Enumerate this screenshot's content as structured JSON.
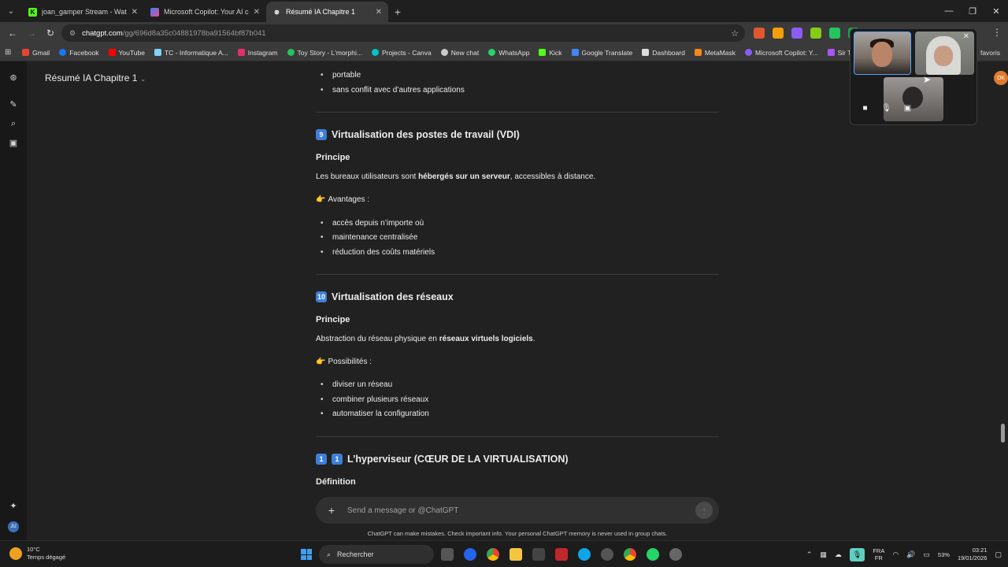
{
  "browser": {
    "tabs": [
      {
        "label": "joan_gamper Stream - Watch Li",
        "color": "#53fc18",
        "glyph": "K"
      },
      {
        "label": "Microsoft Copilot: Your AI com",
        "color": "#8a5cf6",
        "glyph": "◉"
      },
      {
        "label": "Résumé IA Chapitre 1",
        "color": "#ffffff",
        "glyph": "⊛"
      }
    ],
    "url_domain": "chatgpt.com",
    "url_path": "/gg/696d8a35c04881978ba91564bf87b041",
    "bookmarks": [
      {
        "label": "Gmail",
        "color": "#ea4335"
      },
      {
        "label": "Facebook",
        "color": "#1877f2"
      },
      {
        "label": "YouTube",
        "color": "#ff0000"
      },
      {
        "label": "TC - Informatique A...",
        "color": "#7dd3fc"
      },
      {
        "label": "Instagram",
        "color": "#e1306c"
      },
      {
        "label": "Toy Story - L'morphi...",
        "color": "#22c55e"
      },
      {
        "label": "Projects - Canva",
        "color": "#00c4cc"
      },
      {
        "label": "New chat",
        "color": "#cccccc"
      },
      {
        "label": "WhatsApp",
        "color": "#25d366"
      },
      {
        "label": "Kick",
        "color": "#53fc18"
      },
      {
        "label": "Google Translate",
        "color": "#4285f4"
      },
      {
        "label": "Dashboard",
        "color": "#dddddd"
      },
      {
        "label": "MetaMask",
        "color": "#f6851b"
      },
      {
        "label": "Microsoft Copilot: Y...",
        "color": "#8a5cf6"
      },
      {
        "label": "Sir TV - ...",
        "color": "#a855f7"
      }
    ],
    "bookmarks_other": "favoris"
  },
  "chat": {
    "title": "Résumé IA Chapitre 1",
    "user_initials": "OK",
    "sidebar_avatar": "JU"
  },
  "doc": {
    "top_items": [
      "portable",
      "sans conflit avec d’autres applications"
    ],
    "s9": {
      "badge": "9",
      "title": "Virtualisation des postes de travail (VDI)",
      "principe": "Principe",
      "text_before": "Les bureaux utilisateurs sont ",
      "text_bold": "hébergés sur un serveur",
      "text_after": ", accessibles à distance.",
      "sub": "Avantages :",
      "items": [
        "accès depuis n’importe où",
        "maintenance centralisée",
        "réduction des coûts matériels"
      ]
    },
    "s10": {
      "badge": "10",
      "title": "Virtualisation des réseaux",
      "principe": "Principe",
      "text_before": "Abstraction du réseau physique en ",
      "text_bold": "réseaux virtuels logiciels",
      "text_after": ".",
      "sub": "Possibilités :",
      "items": [
        "diviser un réseau",
        "combiner plusieurs réseaux",
        "automatiser la configuration"
      ]
    },
    "s11": {
      "badge_a": "1",
      "badge_b": "1",
      "title": "L’hyperviseur (CŒUR DE LA VIRTUALISATION)",
      "sub": "Définition"
    }
  },
  "composer": {
    "placeholder": "Send a message or @ChatGPT",
    "disclaimer": "ChatGPT can make mistakes. Check important info. Your personal ChatGPT memory is never used in group chats."
  },
  "taskbar": {
    "temp": "10°C",
    "weather": "Temps dégagé",
    "search": "Rechercher",
    "lang1": "FRA",
    "lang2": "FR",
    "battery": "53%",
    "time": "03:21",
    "date": "19/01/2026"
  }
}
